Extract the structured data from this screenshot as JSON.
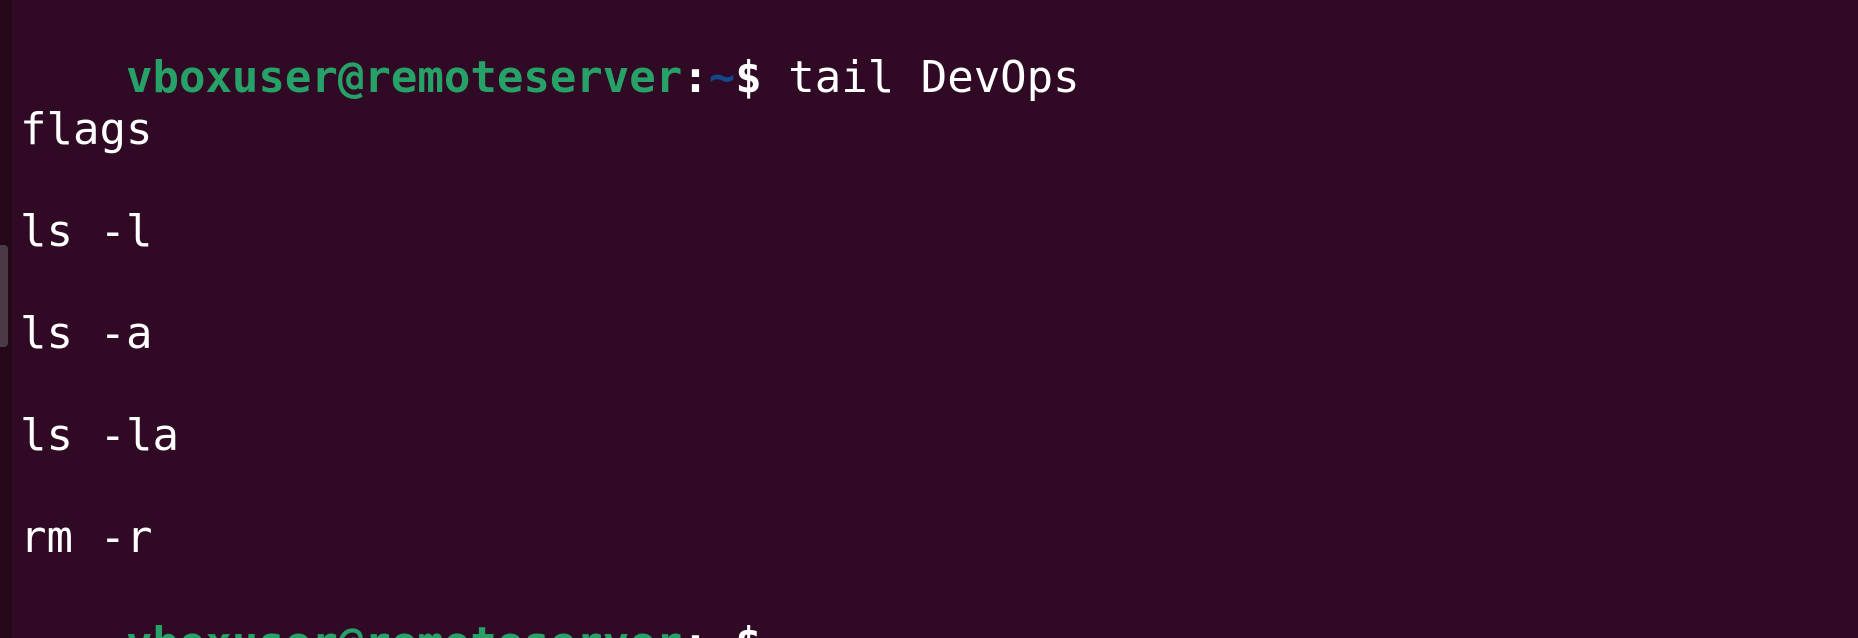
{
  "terminal": {
    "prompt_user_host": "vboxuser@remoteserver",
    "prompt_colon": ":",
    "prompt_path": "~",
    "prompt_symbol": "$",
    "command": " tail DevOps",
    "output": [
      "flags",
      "ls -l",
      "ls -a",
      "ls -la",
      "rm -r"
    ],
    "final_prompt": {
      "user_host": "vboxuser@remoteserver",
      "colon": ":",
      "path": "~",
      "symbol": "$"
    }
  },
  "colors": {
    "background": "#300a24",
    "user_host": "#26a269",
    "path": "#12488b",
    "text": "#ffffff"
  }
}
